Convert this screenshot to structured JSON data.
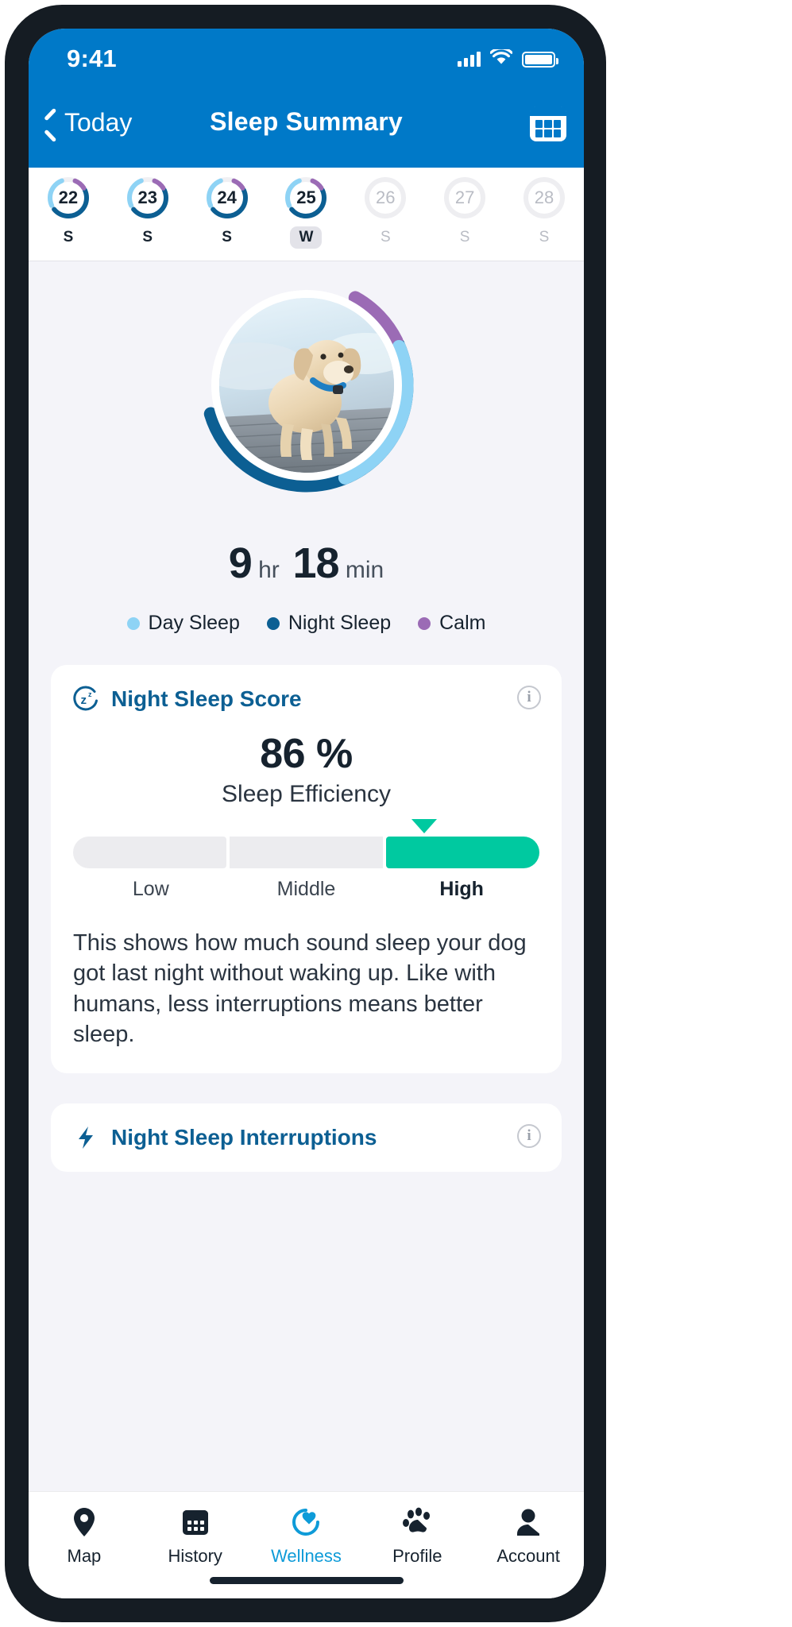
{
  "status_bar": {
    "time": "9:41",
    "cellular_icon": "cellular-bars-icon",
    "wifi_icon": "wifi-icon",
    "battery_icon": "battery-full-icon"
  },
  "nav": {
    "back_label": "Today",
    "title": "Sleep Summary",
    "calendar_icon": "calendar-icon",
    "back_icon": "chevron-left-icon"
  },
  "date_strip": [
    {
      "day": "22",
      "letter": "S",
      "selected": false,
      "enabled": true
    },
    {
      "day": "23",
      "letter": "S",
      "selected": false,
      "enabled": true
    },
    {
      "day": "24",
      "letter": "S",
      "selected": false,
      "enabled": true
    },
    {
      "day": "25",
      "letter": "W",
      "selected": true,
      "enabled": true
    },
    {
      "day": "26",
      "letter": "S",
      "selected": false,
      "enabled": false
    },
    {
      "day": "27",
      "letter": "S",
      "selected": false,
      "enabled": false
    },
    {
      "day": "28",
      "letter": "S",
      "selected": false,
      "enabled": false
    }
  ],
  "hero": {
    "photo_alt": "dog-photo",
    "hours": "9",
    "hours_unit": "hr",
    "minutes": "18",
    "minutes_unit": "min"
  },
  "legend": [
    {
      "label": "Day Sleep",
      "color": "#8ed3f5"
    },
    {
      "label": "Night Sleep",
      "color": "#0c5f93"
    },
    {
      "label": "Calm",
      "color": "#9b6bb5"
    }
  ],
  "night_sleep_score": {
    "icon": "sleep-zz-icon",
    "title": "Night Sleep Score",
    "info_icon": "info-icon",
    "value": "86 %",
    "subtitle": "Sleep Efficiency",
    "gauge_labels": [
      "Low",
      "Middle",
      "High"
    ],
    "gauge_active_index": 2,
    "body": "This shows how much sound sleep your dog got last night without waking up. Like with humans, less interruptions means better sleep."
  },
  "night_sleep_interruptions": {
    "icon": "interruption-bolt-icon",
    "title": "Night Sleep Interruptions",
    "info_icon": "info-icon"
  },
  "tabs": [
    {
      "label": "Map",
      "icon": "location-pin-icon",
      "active": false
    },
    {
      "label": "History",
      "icon": "calendar-icon",
      "active": false
    },
    {
      "label": "Wellness",
      "icon": "heart-pulse-icon",
      "active": true
    },
    {
      "label": "Profile",
      "icon": "paw-print-icon",
      "active": false
    },
    {
      "label": "Account",
      "icon": "person-icon",
      "active": false
    }
  ],
  "colors": {
    "brand_blue": "#0079c8",
    "dark_blue": "#0c5f93",
    "light_blue": "#8ed3f5",
    "purple": "#9b6bb5",
    "green": "#00c9a0",
    "screen_bg": "#f4f4f9"
  },
  "chart_data": {
    "type": "pie",
    "title": "Sleep composition ring",
    "categories": [
      "Night Sleep",
      "Calm",
      "Day Sleep"
    ],
    "values": [
      52,
      10,
      26
    ],
    "unit": "percent of ring",
    "colors": [
      "#0c5f93",
      "#9b6bb5",
      "#8ed3f5"
    ],
    "legend": "below",
    "center_label": "9 hr 18 min"
  }
}
